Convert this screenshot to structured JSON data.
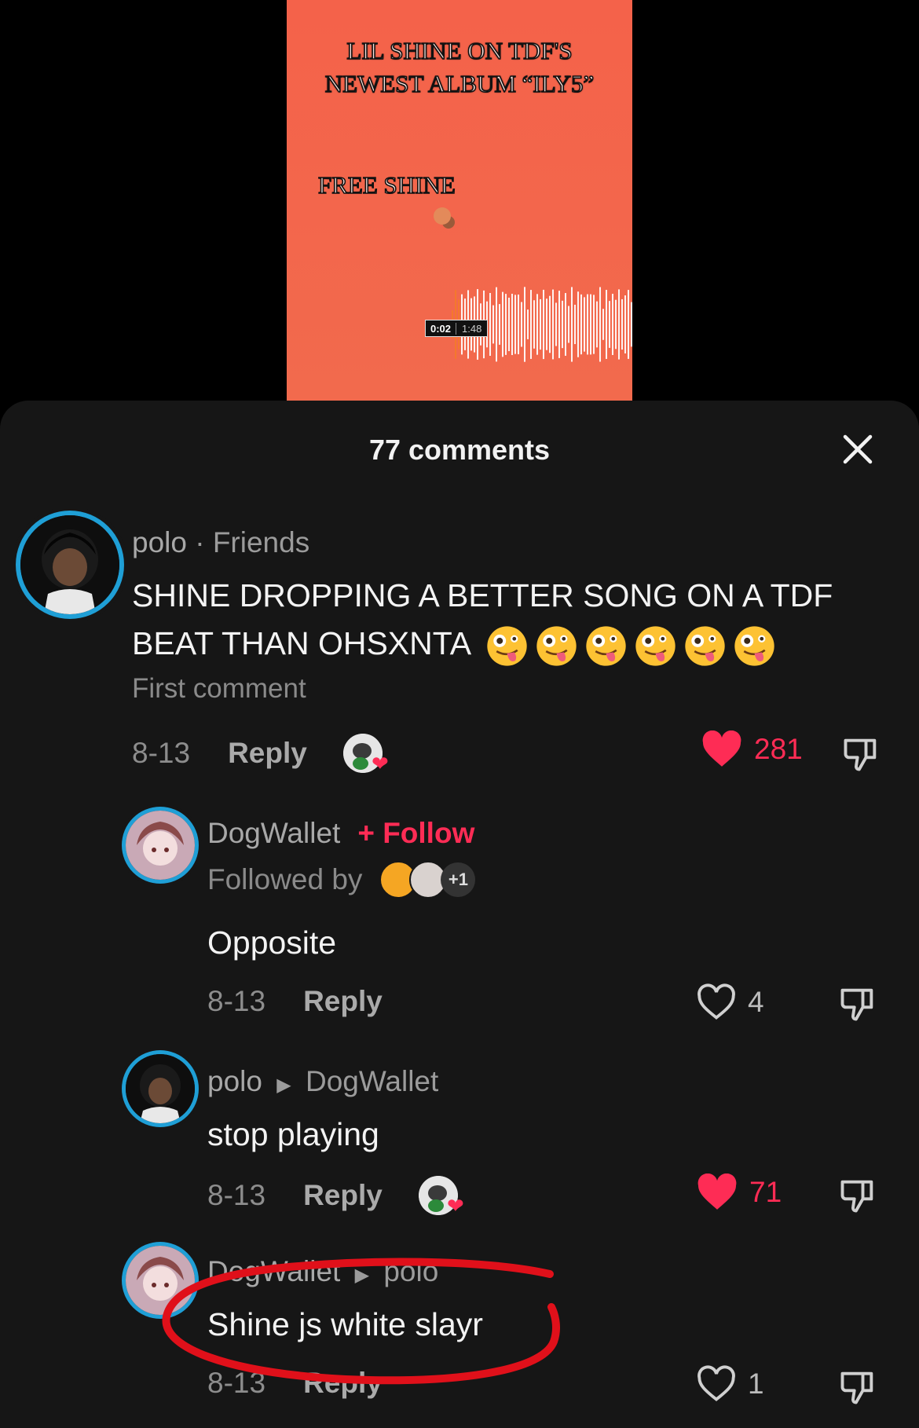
{
  "video": {
    "title_line1": "LIL SHINE ON TDF'S",
    "title_line2": "NEWEST ALBUM “ILY5”",
    "subtitle": "FREE SHINE",
    "time_current": "0:02",
    "time_total": "1:48",
    "progress": 0.02
  },
  "sheet": {
    "title": "77 comments",
    "close_icon": "close-icon"
  },
  "comments": [
    {
      "author": "polo",
      "relation": "· Friends",
      "text": "SHINE DROPPING A BETTER SONG ON A TDF BEAT THAN OHSXNTA",
      "emoji_count": 6,
      "note": "First comment",
      "date": "8-13",
      "reply_label": "Reply",
      "likes": "281",
      "liked": true
    },
    {
      "author": "DogWallet",
      "follow_label": "+ Follow",
      "followed_by_label": "Followed by",
      "followed_extra": "+1",
      "text": "Opposite",
      "date": "8-13",
      "reply_label": "Reply",
      "likes": "4",
      "liked": false
    },
    {
      "author": "polo",
      "reply_to": "DogWallet",
      "text": "stop playing",
      "date": "8-13",
      "reply_label": "Reply",
      "likes": "71",
      "liked": true
    },
    {
      "author": "DogWallet",
      "reply_to": "polo",
      "text": "Shine js white slayr",
      "date": "8-13",
      "reply_label": "Reply",
      "likes": "1",
      "liked": false
    }
  ],
  "colors": {
    "accent": "#fe2c55",
    "video_bg": "#f4624a",
    "annotation": "#e0101a"
  }
}
